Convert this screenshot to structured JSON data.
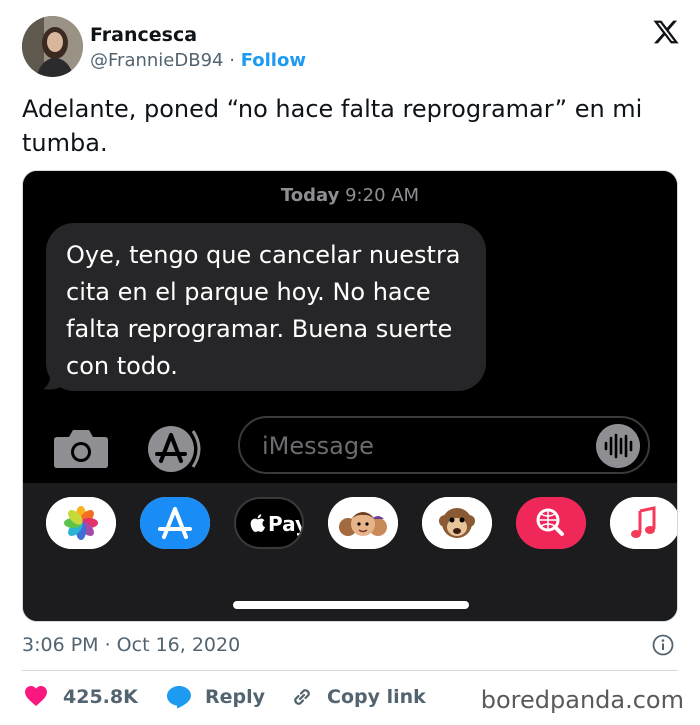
{
  "tweet": {
    "author_name": "Francesca",
    "handle": "@FrannieDB94",
    "separator": "·",
    "follow_label": "Follow",
    "text": "Adelante, poned “no hace falta reprogramar” en mi tumba.",
    "timestamp": "3:06 PM · Oct 16, 2020"
  },
  "screenshot": {
    "stamp_day": "Today",
    "stamp_time": "9:20 AM",
    "message": "Oye, tengo que cancelar nuestra cita en el parque hoy. No hace falta reprogramar. Buena suerte con todo.",
    "input_placeholder": "iMessage",
    "apple_pay_label": "Pay",
    "apps": [
      "photos-icon",
      "app-store-icon",
      "apple-pay-icon",
      "memoji-icon",
      "animoji-monkey-icon",
      "search-web-icon",
      "music-icon"
    ]
  },
  "actions": {
    "likes": "425.8K",
    "reply_label": "Reply",
    "copy_label": "Copy link"
  },
  "watermark": "boredpanda.com",
  "colors": {
    "accent": "#1d9bf0",
    "like": "#f91880",
    "bubble": "#262628",
    "text_secondary": "#536471"
  }
}
